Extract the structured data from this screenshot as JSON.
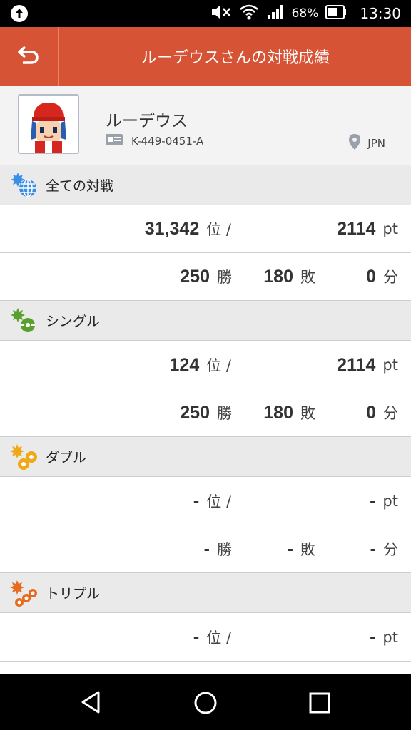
{
  "status_bar": {
    "battery": "68%",
    "time": "13:30"
  },
  "app_bar": {
    "title": "ルーデウスさんの対戦成績"
  },
  "profile": {
    "name": "ルーデウス",
    "player_id": "K-449-0451-A",
    "location": "JPN"
  },
  "sections": [
    {
      "label": "全ての対戦",
      "rank": "31,342",
      "rank_unit": "位 /",
      "points": "2114",
      "points_unit": "pt",
      "wins": "250",
      "wins_unit": "勝",
      "losses": "180",
      "losses_unit": "敗",
      "draws": "0",
      "draws_unit": "分"
    },
    {
      "label": "シングル",
      "rank": "124",
      "rank_unit": "位 /",
      "points": "2114",
      "points_unit": "pt",
      "wins": "250",
      "wins_unit": "勝",
      "losses": "180",
      "losses_unit": "敗",
      "draws": "0",
      "draws_unit": "分"
    },
    {
      "label": "ダブル",
      "rank": "-",
      "rank_unit": "位 /",
      "points": "-",
      "points_unit": "pt",
      "wins": "-",
      "wins_unit": "勝",
      "losses": "-",
      "losses_unit": "敗",
      "draws": "-",
      "draws_unit": "分"
    },
    {
      "label": "トリプル",
      "rank": "-",
      "rank_unit": "位 /",
      "points": "-",
      "points_unit": "pt"
    }
  ],
  "colors": {
    "app_bar": "#d75335",
    "globe_icon": "#3a8ee6",
    "single_icon": "#5aa02c",
    "double_icon": "#f0a818",
    "triple_icon": "#e86a1c"
  },
  "icons": {
    "status_left": "upload-notification-icon",
    "mute": "volume-mute-icon",
    "wifi": "wifi-icon",
    "signal": "signal-icon",
    "battery": "battery-icon",
    "back": "back-arrow-icon",
    "id_card": "id-card-icon",
    "location": "location-pin-icon",
    "nav_back": "nav-back-icon",
    "nav_home": "nav-home-icon",
    "nav_recents": "nav-recents-icon"
  }
}
